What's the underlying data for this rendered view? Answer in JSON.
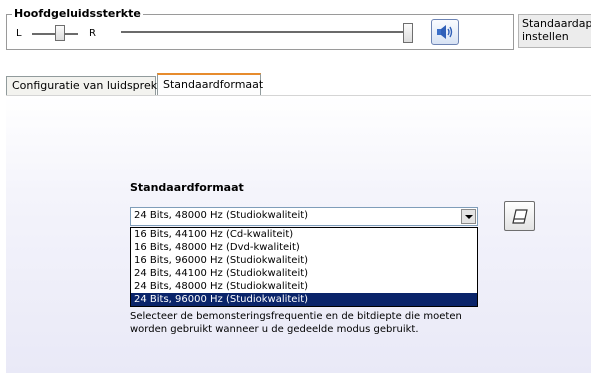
{
  "master_volume": {
    "title": "Hoofdgeluidssterkte",
    "left_label": "L",
    "right_label": "R",
    "balance_level": 0.5,
    "volume_level": 1.0
  },
  "default_device_button": {
    "label": "Standaardapp\ninstellen"
  },
  "tabs": [
    {
      "label": "Configuratie van luidsprekers",
      "active": false
    },
    {
      "label": "Standaardformaat",
      "active": true
    }
  ],
  "default_format": {
    "section_title": "Standaardformaat",
    "selected_value": "24 Bits, 48000 Hz (Studiokwaliteit)",
    "options": [
      "16 Bits, 44100 Hz (Cd-kwaliteit)",
      "16 Bits, 48000 Hz (Dvd-kwaliteit)",
      "16 Bits, 96000 Hz (Studiokwaliteit)",
      "24 Bits, 44100 Hz (Studiokwaliteit)",
      "24 Bits, 48000 Hz (Studiokwaliteit)",
      "24 Bits, 96000 Hz (Studiokwaliteit)"
    ],
    "highlighted_index": 5,
    "help_text": "Selecteer de bemonsteringsfrequentie en de bitdiepte die moeten worden gebruikt wanneer u de gedeelde modus gebruikt."
  },
  "icons": {
    "speaker": "speaker-icon",
    "test": "eraser-icon"
  },
  "colors": {
    "selection_bg": "#0a246a",
    "active_tab_accent": "#e68b2c"
  }
}
